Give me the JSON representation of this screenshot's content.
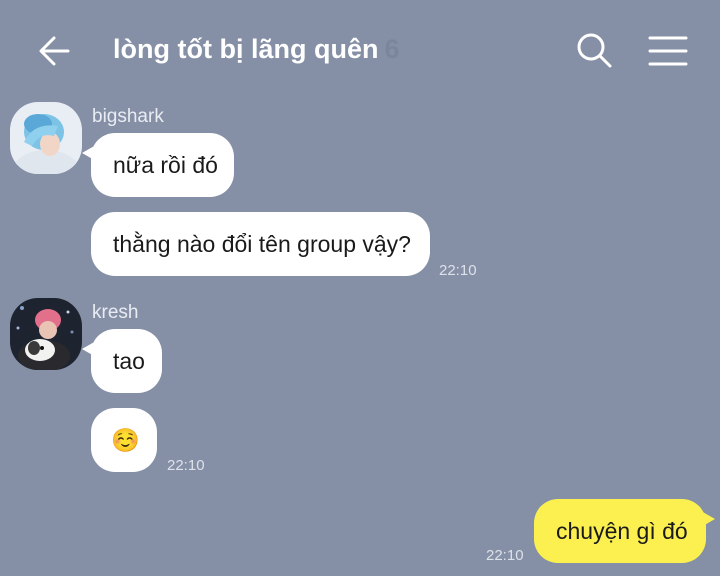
{
  "header": {
    "title": "lòng tốt bị lãng quên",
    "member_count": "6",
    "icons": [
      "back-arrow-icon",
      "search-icon",
      "menu-icon"
    ]
  },
  "messages": [
    {
      "sender": "bigshark",
      "avatar": "avatar-blue-hair",
      "bubbles": [
        "nữa rồi đó",
        "thằng nào đổi tên group vậy?"
      ],
      "time": "22:10"
    },
    {
      "sender": "kresh",
      "avatar": "avatar-pink-hair-dog",
      "bubbles": [
        "tao",
        "☺️"
      ],
      "time": "22:10"
    },
    {
      "sender": "me",
      "bubbles": [
        "chuyện gì đó"
      ],
      "time": "22:10"
    }
  ],
  "colors": {
    "background": "#8590a6",
    "incoming_bubble": "#ffffff",
    "outgoing_bubble": "#fbf050"
  }
}
